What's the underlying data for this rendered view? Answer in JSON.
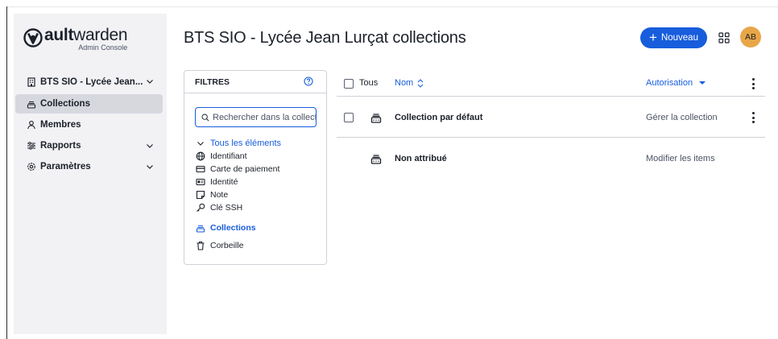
{
  "app": {
    "logo_bold": "ault",
    "logo_rest": "warden",
    "logo_sub": "Admin Console"
  },
  "sidebar": {
    "org_name": "BTS SIO - Lycée Jean...",
    "items": [
      {
        "label": "Collections",
        "icon": "collection-icon",
        "active": true
      },
      {
        "label": "Membres",
        "icon": "users-icon"
      },
      {
        "label": "Rapports",
        "icon": "sliders-icon",
        "expandable": true
      },
      {
        "label": "Paramètres",
        "icon": "gear-icon",
        "expandable": true
      }
    ]
  },
  "header": {
    "title": "BTS SIO - Lycée Jean Lurçat collections",
    "new_button": "Nouveau",
    "avatar_initials": "AB",
    "accent_color": "#175ddc",
    "avatar_color": "#e8a648"
  },
  "filters": {
    "title": "FILTRES",
    "search_placeholder": "Rechercher dans la collection",
    "all_items": "Tous les éléments",
    "types": [
      {
        "label": "Identifiant",
        "icon": "globe-icon"
      },
      {
        "label": "Carte de paiement",
        "icon": "credit-card-icon"
      },
      {
        "label": "Identité",
        "icon": "id-card-icon"
      },
      {
        "label": "Note",
        "icon": "sticky-note-icon"
      },
      {
        "label": "Clé SSH",
        "icon": "key-icon"
      }
    ],
    "collections": "Collections",
    "trash": "Corbeille"
  },
  "table": {
    "col_all": "Tous",
    "col_name": "Nom",
    "col_permission": "Autorisation",
    "rows": [
      {
        "name": "Collection par défaut",
        "permission": "Gérer la collection",
        "has_checkbox": true,
        "has_menu": true
      },
      {
        "name": "Non attribué",
        "permission": "Modifier les items",
        "has_checkbox": false,
        "has_menu": false
      }
    ]
  }
}
